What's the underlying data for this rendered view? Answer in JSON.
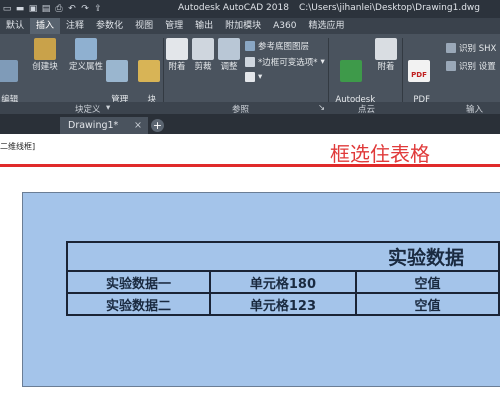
{
  "window": {
    "app_title": "Autodesk AutoCAD 2018",
    "file_path": "C:\\Users\\jihanlei\\Desktop\\Drawing1.dwg",
    "quick_access_icons": [
      "new-icon",
      "open-icon",
      "save-icon",
      "saveas-icon",
      "print-icon",
      "undo-icon",
      "redo-icon",
      "share-icon"
    ]
  },
  "ribbon_tabs": [
    "默认",
    "插入",
    "注释",
    "参数化",
    "视图",
    "管理",
    "输出",
    "附加模块",
    "A360",
    "精选应用"
  ],
  "active_tab": "插入",
  "ribbon": {
    "block_panel": {
      "edit_attr": "编辑\n属性",
      "create_block": "创建块",
      "define_attr": "定义属性",
      "manage_attr": "管理\n属性",
      "block_editor": "块\n编辑器",
      "label": "块定义"
    },
    "ref_panel": {
      "attach": "附着",
      "clip": "剪裁",
      "adjust": "调整",
      "underlay_layers": "参考底图图层",
      "frame_option": "*边框可变选项*",
      "label": "参照"
    },
    "pointcloud_panel": {
      "recap": "Autodesk\nReCap",
      "attach": "附着",
      "label": "点云"
    },
    "import_panel": {
      "pdf_import": "PDF\n输入",
      "pdf_badge": "PDF",
      "recognize_shx": "识别 SHX",
      "recognize_settings": "识别 设置",
      "label": "输入"
    }
  },
  "doc_tabs": {
    "current": "Drawing1*",
    "close": "×",
    "add": "+"
  },
  "viewport_label": "二维线框]",
  "annotation": "框选住表格",
  "table": {
    "title": "实验数据",
    "rows": [
      [
        "实验数据一",
        "单元格180",
        "空值"
      ],
      [
        "实验数据二",
        "单元格123",
        "空值"
      ]
    ]
  },
  "colors": {
    "annotation": "#e03a3a",
    "drawing_bg": "#a4c4ea",
    "ribbon": "#4a535e"
  }
}
